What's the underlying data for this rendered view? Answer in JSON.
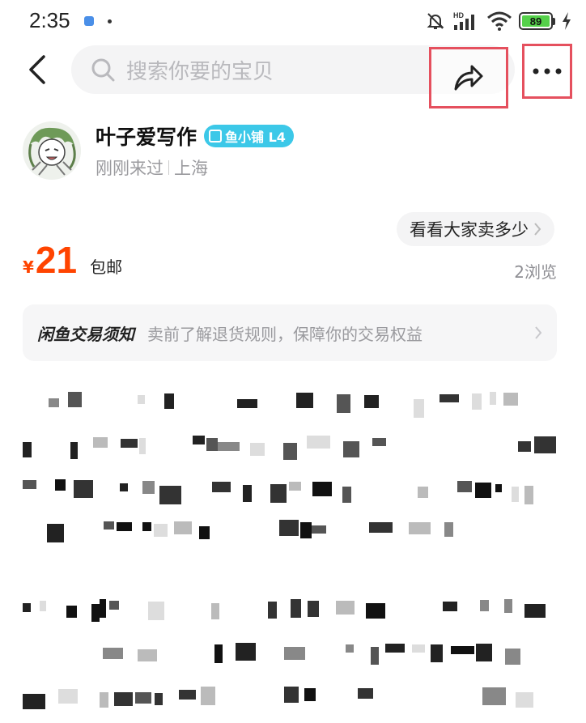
{
  "status_bar": {
    "time": "2:35",
    "battery": "89",
    "icons": [
      "mute-bell-icon",
      "hd-signal-icon",
      "wifi-icon",
      "battery-icon",
      "charging-icon"
    ]
  },
  "nav": {
    "search_placeholder": "搜索你要的宝贝",
    "icons": [
      "back-arrow-icon",
      "search-icon",
      "share-icon",
      "more-icon"
    ]
  },
  "seller": {
    "name": "叶子爱写作",
    "badge": "鱼小铺 L4",
    "last_seen": "刚刚来过",
    "location": "上海"
  },
  "listing": {
    "compare_label": "看看大家卖多少",
    "currency": "¥",
    "price": "21",
    "shipping": "包邮",
    "views": "2浏览"
  },
  "notice": {
    "title": "闲鱼交易须知",
    "text": "卖前了解退货规则，保障你的交易权益"
  },
  "colors": {
    "accent_price": "#ff4400",
    "badge": "#3cc8e8",
    "highlight_box": "#e5505e"
  }
}
